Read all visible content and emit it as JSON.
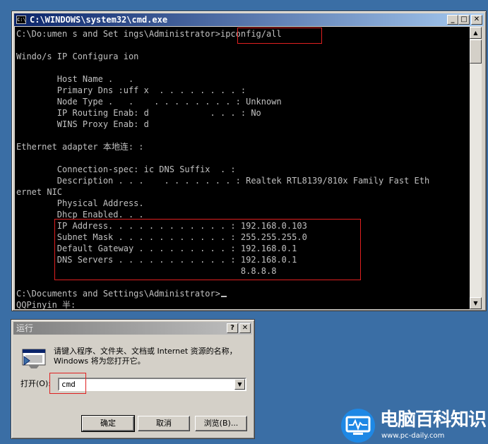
{
  "cmd_window": {
    "title": "C:\\WINDOWS\\system32\\cmd.exe",
    "app_icon_text": "C:\\",
    "minimize": "_",
    "maximize": "□",
    "close": "✕",
    "lines": [
      "C:\\Do:umen s and Set ings\\Administrator>ipconfig/all",
      "",
      "Windo/s IP Configura ion",
      "",
      "        Host Name .   .",
      "        Primary Dns :uff x  . . . . . . . . :",
      "        Node Type .   .    . . . . . . . . : Unknown",
      "        IP Routing Enab: d            . . . : No",
      "        WINS Proxy Enab: d",
      "",
      "Ethernet adapter 本地连: :",
      "",
      "        Connection-spec: ic DNS Suffix  . :",
      "        Description . . .    . . . . . . . : Realtek RTL8139/810x Family Fast Eth",
      "ernet NIC",
      "        Physical Address.",
      "        Dhcp Enabled. . .",
      "        IP Address. . . . . . . . . . . . : 192.168.0.103",
      "        Subnet Mask . . . . . . . . . . . : 255.255.255.0",
      "        Default Gateway . . . . . . . . . : 192.168.0.1",
      "        DNS Servers . . . . . . . . . . . : 192.168.0.1",
      "                                            8.8.8.8",
      "",
      "C:\\Documents and Settings\\Administrator>",
      "QQPinyin 半:"
    ],
    "scroll_up": "▲",
    "scroll_down": "▼"
  },
  "run_dialog": {
    "title": "运行",
    "help": "?",
    "close": "✕",
    "description": "请键入程序、文件夹、文档或 Internet 资源的名称，Windows 将为您打开它。",
    "open_label": "打开(O):",
    "open_value": "cmd",
    "dropdown_arrow": "▼",
    "ok_label": "确定",
    "cancel_label": "取消",
    "browse_label": "浏览(B)..."
  },
  "watermark": {
    "brand": "电脑百科知识",
    "url": "www.pc-daily.com"
  },
  "colors": {
    "desktop": "#3a6ea5",
    "console_bg": "#000000",
    "console_text": "#c0c0c0",
    "highlight_box": "#e02020",
    "active_title": "#0a246a",
    "inactive_title": "#808080",
    "watermark_blue": "#1e88e5"
  }
}
